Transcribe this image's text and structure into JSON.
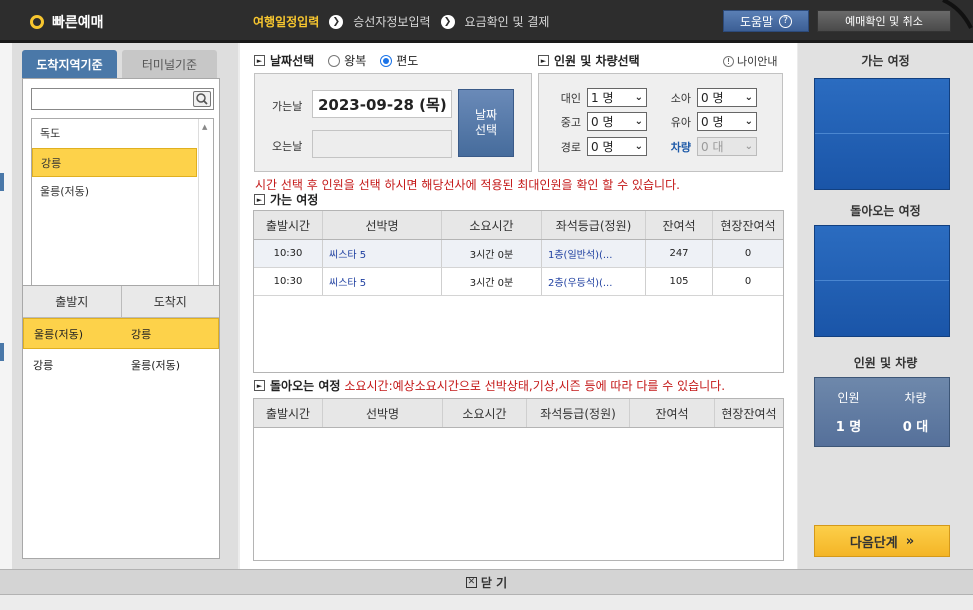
{
  "header": {
    "title": "빠른예매",
    "steps": [
      "여행일정입력",
      "승선자정보입력",
      "요금확인 및 결제"
    ],
    "help_label": "도움말",
    "reservation_label": "예매확인 및 취소"
  },
  "left": {
    "tabs": [
      "도착지역기준",
      "터미널기준"
    ],
    "regions": [
      "독도",
      "강릉",
      "울릉(저동)"
    ],
    "route_headers": [
      "출발지",
      "도착지"
    ],
    "routes": [
      {
        "from": "울릉(저동)",
        "to": "강릉"
      },
      {
        "from": "강릉",
        "to": "울릉(저동)"
      }
    ]
  },
  "date": {
    "title": "날짜선택",
    "round_label": "왕복",
    "oneway_label": "편도",
    "depart_label": "가는날",
    "depart_value": "2023-09-28 (목)",
    "return_label": "오는날",
    "return_value": "",
    "select_btn_line1": "날짜",
    "select_btn_line2": "선택"
  },
  "pax": {
    "title": "인원 및 차량선택",
    "age_info": "나이안내",
    "adult_label": "대인",
    "adult_value": "1 명",
    "child_label": "소아",
    "child_value": "0 명",
    "teen_label": "중고",
    "teen_value": "0 명",
    "infant_label": "유아",
    "infant_value": "0 명",
    "senior_label": "경로",
    "senior_value": "0 명",
    "car_label": "차량",
    "car_value": "0 대"
  },
  "notice": "시간 선택 후 인원을 선택 하시면 해당선사에 적용된 최대인원을 확인 할 수 있습니다.",
  "go": {
    "title": "가는 여정",
    "headers": [
      "출발시간",
      "선박명",
      "소요시간",
      "좌석등급(정원)",
      "잔여석",
      "현장잔여석"
    ],
    "rows": [
      {
        "time": "10:30",
        "ship": "씨스타 5",
        "duration": "3시간 0분",
        "grade": "1층(일반석)(...",
        "seats": "247",
        "onsite": "0"
      },
      {
        "time": "10:30",
        "ship": "씨스타 5",
        "duration": "3시간 0분",
        "grade": "2층(우등석)(...",
        "seats": "105",
        "onsite": "0"
      }
    ]
  },
  "ret": {
    "title": "돌아오는 여정",
    "note": "소요시간:예상소요시간으로 선박상태,기상,시즌 등에 따라 다를 수 있습니다.",
    "headers": [
      "출발시간",
      "선박명",
      "소요시간",
      "좌석등급(정원)",
      "잔여석",
      "현장잔여석"
    ]
  },
  "right": {
    "go_title": "가는 여정",
    "return_title": "돌아오는 여정",
    "pax_title": "인원 및 차량",
    "pax_label": "인원",
    "pax_value": "1 명",
    "car_label": "차량",
    "car_value": "0 대",
    "next_label": "다음단계"
  },
  "footer": {
    "close_label": "닫 기"
  },
  "colors": {
    "accent": "#f7c62f",
    "blue": "#1a55a8",
    "highlight": "#fdd24a",
    "notice": "#c41818"
  }
}
